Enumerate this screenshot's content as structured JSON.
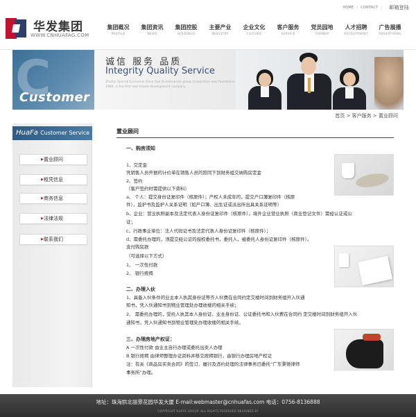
{
  "toplinks": {
    "home": "HOME",
    "contact": "CONTACT",
    "sep": "|",
    "lang": "邮箱登陆"
  },
  "brand": {
    "name_cn": "华发集团",
    "url": "WWW.CNHUAFAG.COM"
  },
  "nav": [
    {
      "cn": "集团概况",
      "en": "PROFILE"
    },
    {
      "cn": "集团资讯",
      "en": "NEWS"
    },
    {
      "cn": "集团控股",
      "en": "HOLDINGS"
    },
    {
      "cn": "主要产业",
      "en": "INDUSTRY"
    },
    {
      "cn": "企业文化",
      "en": "CULTURE"
    },
    {
      "cn": "客户服务",
      "en": "SERVICE"
    },
    {
      "cn": "党员园地",
      "en": "CORNER"
    },
    {
      "cn": "人才招聘",
      "en": "RECRUITMENT"
    },
    {
      "cn": "广告展播",
      "en": "ADVERTISING"
    }
  ],
  "banner": {
    "left_text": "Customer",
    "big_letter": "C",
    "slogan_cn": "诚信  服务  品质",
    "slogan_en": "Integrity Quality Service",
    "slogan_small": "Zhuhai Special Economic Zone hua fa enterprise group corporation was founded in 1980, is the first real estate development company"
  },
  "breadcrumb": "首页 > 客户服务 > 置业顾问",
  "sidebar": {
    "title_main": "HuaFa",
    "title_sub": "Customer Service",
    "items": [
      "置业顾问",
      "租凭信息",
      "商务信息",
      "法律法规",
      "联系我们"
    ]
  },
  "content": {
    "title": "置业顾问",
    "s1_title": "一、购房须知",
    "l1": "1、交定金",
    "l2": "凭销售人员开据的计价单在销售人员的陪同下到财务组交纳购房定金",
    "l3": "2、签约",
    "l4": "（客户签约时需提供以下资料）",
    "l5": "a、 个人：提交身份证复印件（核原件）；产权人未成年的，提交户口簿复印件（核原",
    "l6": "件），监护书及监护人关系证明（如户口簿、出生证或派出所出具关系证明等）",
    "l7": "b、企业：营业执照副本及法定代表人身份证复印件（核原件），境外企业营业执照（商业登记文件）需经认证或公",
    "l8": "证；",
    "l9": "c、行政事业单位：法人代码证书及法定代表人身份证复印件（核原件）；",
    "l10": "d、需委托办理的，须提交经公证的授权委托书，委托人，被委托人身份证复印件（核原件）。",
    "l11": "支付购房款",
    "l12": "（可选择以下方式）",
    "l13": "1、 一次性付款",
    "l14": "2、 银行按揭",
    "s2_title": "二、办理入伙",
    "l15": "1、具备入伙条件的业主本人执其身份证等齐入伙费在合同约定交楼时间到财务组开入伙通",
    "l16": "知书，凭入伙通知书到物业管理处办理收楼的相关手续；",
    "l17": "2、  需委托办理的，受托人执其本人身份证、业主身份证、公证委托书和入伙费在合同约  定交楼时间到财务组开入伙",
    "l18": "通知书，凭入伙通知书到物业管理处办理收楼的相关手续。",
    "s3_title": "三、办理房地产权证：",
    "l19": "A 一次性付款 由业主自行办理或委托出卖人办理",
    "l20": "B 银行按揭 由律师整理办证资料并移交按揭银行，由银行办理房地产权证",
    "l21": "注：有关《商品房买卖合同》的签订、履行及违约处理的法律事务已委托“广东秉德律师",
    "l22": "事务所”办理。"
  },
  "footer": {
    "line": "地址：珠海拱北丽景花园华发大厦 E-mail:webmaster@cnhuafas.com  电话：0756-8136888",
    "copy": "COPYRIGHT HUAFA GROUP. ALL RIGHTS RESERVED  DESIGNED BY"
  },
  "colors": {
    "brand_red": "#c8102e",
    "brand_blue": "#2f5a82",
    "footer": "#3a3a3a"
  }
}
